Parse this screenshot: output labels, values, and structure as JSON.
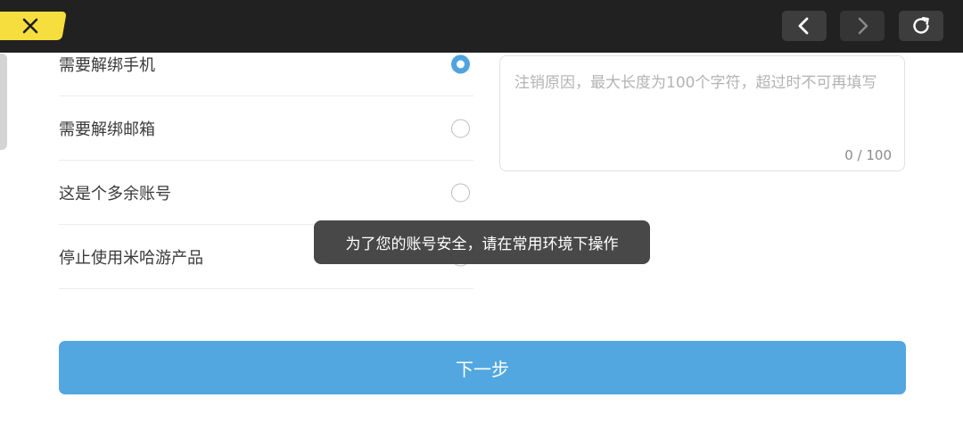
{
  "topbar": {
    "close_icon": "close-icon",
    "back_icon": "chevron-left-icon",
    "forward_icon": "chevron-right-icon",
    "refresh_icon": "refresh-icon",
    "colors": {
      "bar": "#212121",
      "close_tab": "#f7de3f"
    }
  },
  "reasons": {
    "items": [
      {
        "label": "需要解绑手机",
        "selected": true
      },
      {
        "label": "需要解绑邮箱",
        "selected": false
      },
      {
        "label": "这是个多余账号",
        "selected": false
      },
      {
        "label": "停止使用米哈游产品",
        "selected": false
      }
    ]
  },
  "reason_input": {
    "placeholder": "注销原因，最大长度为100个字符，超过时不可再填写",
    "value": "",
    "count": "0",
    "separator": " / ",
    "max": "100"
  },
  "next_button": {
    "label": "下一步",
    "color": "#53a7e0"
  },
  "toast": {
    "text": "为了您的账号安全，请在常用环境下操作"
  },
  "accent_color": "#4fa3e0"
}
